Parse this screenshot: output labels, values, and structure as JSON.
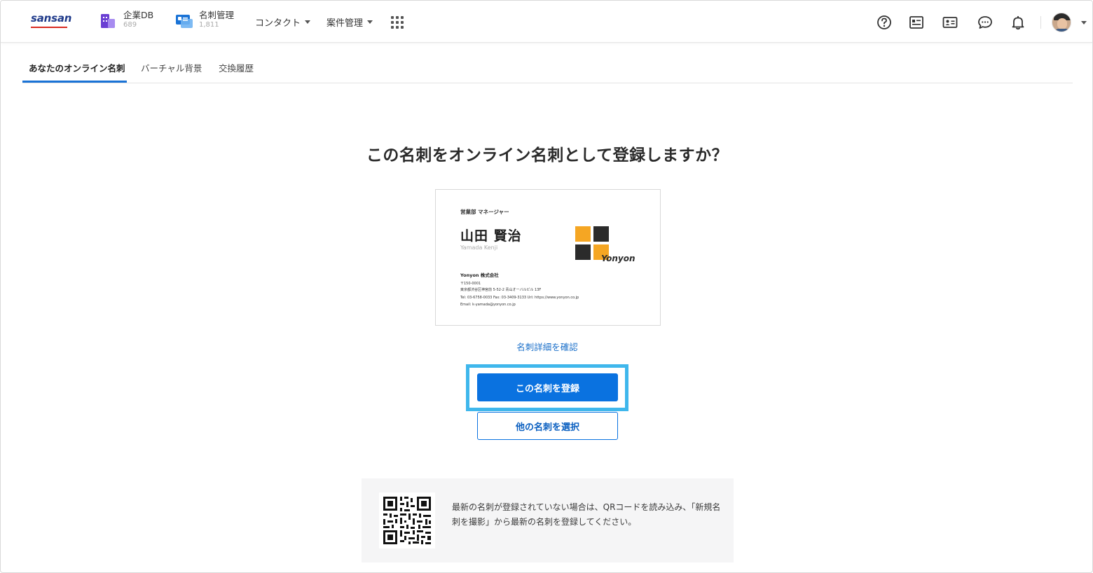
{
  "brand": {
    "logo_text": "sansan",
    "accent": "#d9281f",
    "primary": "#0a72e0"
  },
  "nav": {
    "apps": [
      {
        "label": "企業DB",
        "count": "689",
        "icon": "company-db-icon"
      },
      {
        "label": "名刺管理",
        "count": "1,811",
        "icon": "business-card-icon"
      }
    ],
    "dropdowns": [
      {
        "label": "コンタクト"
      },
      {
        "label": "案件管理"
      }
    ],
    "right_icons": [
      "help-icon",
      "card-list-icon",
      "contact-card-icon",
      "chat-icon",
      "bell-icon"
    ]
  },
  "tabs": [
    {
      "label": "あなたのオンライン名刺",
      "active": true
    },
    {
      "label": "バーチャル背景",
      "active": false
    },
    {
      "label": "交換履歴",
      "active": false
    }
  ],
  "main": {
    "heading": "この名刺をオンライン名刺として登録しますか？",
    "card": {
      "title": "営業部 マネージャー",
      "name": "山田 賢治",
      "romanized": "Yamada Kenji",
      "company": "Yonyon 株式会社",
      "postal": "〒150-0001",
      "address": "東京都渋谷区神宮前 5-52-2 青山オーバルビル 13F",
      "contact_line": "Tel: 03-6758-0033    Fax: 03-3409-3133    Url: https://www.yonyon.co.jp",
      "email": "Email: k-yamada@yonyon.co.jp",
      "logo_text": "Yonyon"
    },
    "detail_link": "名刺詳細を確認",
    "register_button": "この名刺を登録",
    "select_other_button": "他の名刺を選択"
  },
  "qr_panel": {
    "text": "最新の名刺が登録されていない場合は、QRコードを読み込み、「新規名刺を撮影」から最新の名刺を登録してください。"
  }
}
